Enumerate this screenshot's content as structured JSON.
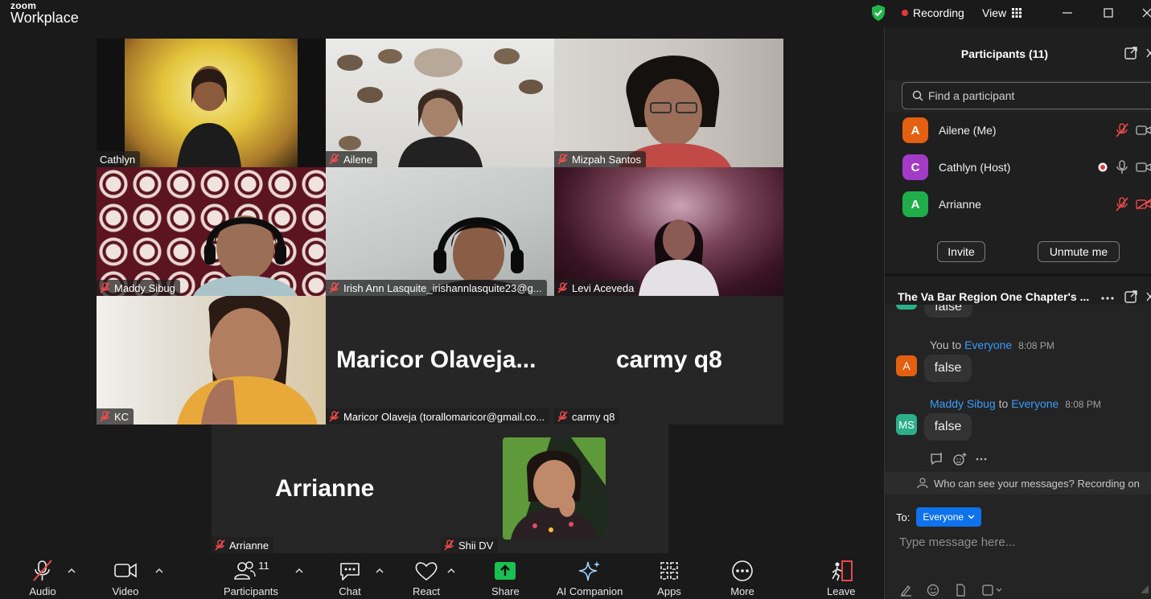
{
  "titlebar": {
    "brand_small": "zoom",
    "brand_large": "Workplace",
    "recording_label": "Recording",
    "view_label": "View"
  },
  "tiles": [
    {
      "name": "Cathlyn",
      "muted": false,
      "active": true
    },
    {
      "name": "Ailene",
      "muted": true
    },
    {
      "name": "Mizpah Santos",
      "muted": true
    },
    {
      "name": "Maddy Sibug",
      "muted": true
    },
    {
      "name": "Irish Ann Lasquite_irishannlasquite23@g...",
      "muted": true
    },
    {
      "name": "Levi Aceveda",
      "muted": true
    },
    {
      "name": "KC",
      "muted": true
    },
    {
      "name": "Maricor Olaveja (torallomaricor@gmail.co...",
      "display": "Maricor  Olaveja...",
      "muted": true
    },
    {
      "name": "carmy q8",
      "display": "carmy q8",
      "muted": true
    },
    {
      "name": "Arrianne",
      "display": "Arrianne",
      "muted": true
    },
    {
      "name": "Shii DV",
      "muted": true
    }
  ],
  "toolbar": {
    "audio": "Audio",
    "video": "Video",
    "participants": "Participants",
    "participants_count": "11",
    "chat": "Chat",
    "react": "React",
    "share": "Share",
    "ai_companion": "AI Companion",
    "apps": "Apps",
    "more": "More",
    "leave": "Leave"
  },
  "participants_panel": {
    "title": "Participants (11)",
    "search_placeholder": "Find a participant",
    "list": [
      {
        "initial": "A",
        "name": "Ailene (Me)",
        "color": "#e2600f"
      },
      {
        "initial": "C",
        "name": "Cathlyn (Host)",
        "color": "#a33bc6"
      },
      {
        "initial": "A",
        "name": "Arrianne",
        "color": "#1fae4a"
      }
    ],
    "invite_label": "Invite",
    "unmute_label": "Unmute me"
  },
  "chat_panel": {
    "title": "The Va Bar Region One Chapter's ...",
    "partial_message": "false",
    "messages": [
      {
        "initial": "A",
        "color": "#e2600f",
        "sender": "You",
        "to_word": "to",
        "recipient": "Everyone",
        "time": "8:08 PM",
        "text": "false"
      },
      {
        "initial": "MS",
        "color": "#2bb08a",
        "sender": "Maddy Sibug",
        "to_word": "to",
        "recipient": "Everyone",
        "time": "8:08 PM",
        "text": "false"
      }
    ],
    "notice": "Who can see your messages? Recording on",
    "to_label": "To:",
    "to_value": "Everyone",
    "input_placeholder": "Type message here..."
  },
  "colors": {
    "accent_green": "#2fd9a0",
    "recording_red": "#e5353a",
    "share_green": "#1ac152",
    "link_blue": "#3b9bff",
    "button_blue": "#0e72ed"
  }
}
